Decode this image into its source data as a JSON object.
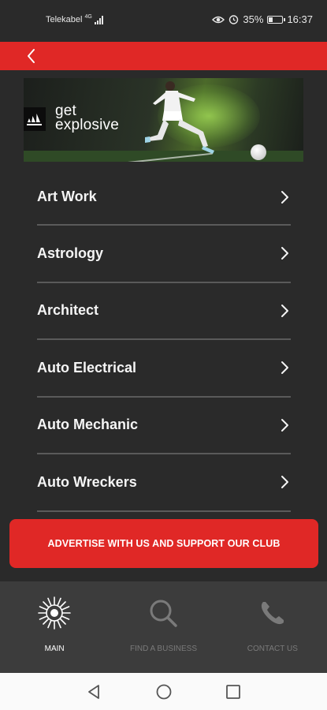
{
  "status_bar": {
    "carrier": "Telekabel",
    "network": "4G",
    "battery": "35%",
    "battery_level": 0.35,
    "time": "16:37"
  },
  "header": {
    "back_icon": "chevron-left-icon"
  },
  "banner": {
    "brand_logo": "adidas-logo",
    "text_line1": "get",
    "text_line2": "explosive"
  },
  "categories": [
    {
      "label": "Art Work"
    },
    {
      "label": "Astrology"
    },
    {
      "label": "Architect"
    },
    {
      "label": "Auto Electrical"
    },
    {
      "label": "Auto Mechanic"
    },
    {
      "label": "Auto Wreckers"
    }
  ],
  "advertise": {
    "label": "ADVERTISE WITH US AND SUPPORT OUR CLUB"
  },
  "bottom_nav": {
    "items": [
      {
        "label": "MAIN",
        "icon": "club-emblem-icon",
        "active": true
      },
      {
        "label": "FIND A BUSINESS",
        "icon": "search-icon",
        "active": false
      },
      {
        "label": "CONTACT US",
        "icon": "phone-icon",
        "active": false
      }
    ]
  },
  "colors": {
    "accent": "#e02826",
    "background": "#2a2a2a",
    "nav_background": "#3c3c3c",
    "inactive": "#7a7a7a"
  }
}
